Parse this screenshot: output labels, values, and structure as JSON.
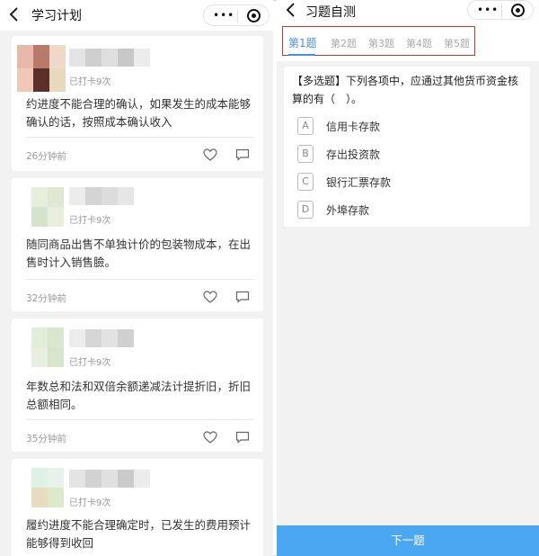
{
  "left": {
    "nav": {
      "back": "<",
      "title": "学习计划",
      "capsule_dots": "•••"
    },
    "posts": [
      {
        "checkin": "已打卡9次",
        "text": "约进度不能合理的确认，如果发生的成本能够确认的话，按照成本确认收入",
        "time": "26分钟前"
      },
      {
        "checkin": "已打卡9次",
        "text": "随同商品出售不单独计价的包装物成本，在出售时计入销售臉。",
        "time": "32分钟前"
      },
      {
        "checkin": "已打卡9次",
        "text": "年数总和法和双倍余额递减法计提折旧，折旧总额相同。",
        "time": "35分钟前"
      },
      {
        "checkin": "已打卡9次",
        "text": "履约进度不能合理确定时，已发生的费用预计能够得到收回",
        "time": ""
      }
    ]
  },
  "right": {
    "nav": {
      "back": "<",
      "title": "习题自测",
      "capsule_dots": "•••"
    },
    "tabs": [
      "第1题",
      "第2题",
      "第3题",
      "第4题",
      "第5题"
    ],
    "question": {
      "text": "【多选题】下列各项中，应通过其他货币资金核算的有（　）。",
      "options": [
        {
          "letter": "A",
          "text": "信用卡存款"
        },
        {
          "letter": "B",
          "text": "存出投资款"
        },
        {
          "letter": "C",
          "text": "银行汇票存款"
        },
        {
          "letter": "D",
          "text": "外埠存款"
        }
      ]
    },
    "next_label": "下一题"
  },
  "colors": {
    "accent": "#4a90e2",
    "next_button": "#4aa8f0",
    "highlight_box": "#c0392b"
  },
  "icons": {
    "back": "chevron-left-icon",
    "more": "more-dots-icon",
    "target": "target-icon",
    "like": "heart-icon",
    "comment": "comment-icon"
  }
}
